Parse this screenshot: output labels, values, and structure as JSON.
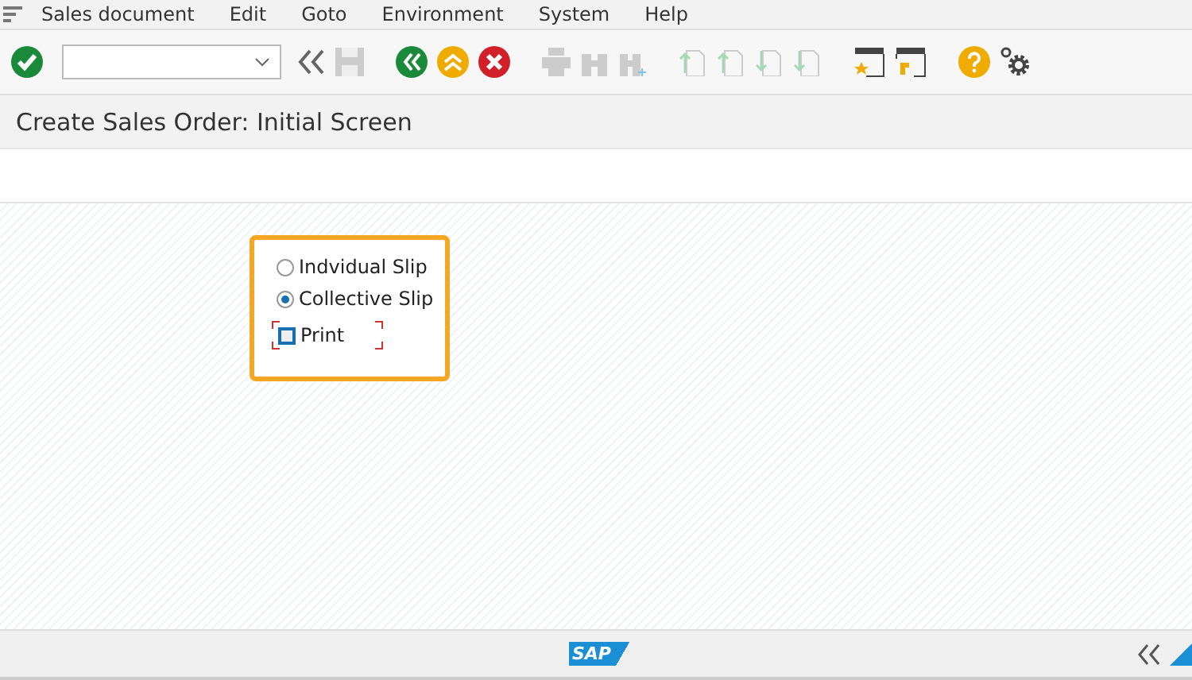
{
  "menu": [
    "Sales document",
    "Edit",
    "Goto",
    "Environment",
    "System",
    "Help"
  ],
  "title": "Create Sales Order: Initial Screen",
  "options": [
    {
      "kind": "radio",
      "label": "Indvidual Slip",
      "selected": false
    },
    {
      "kind": "radio",
      "label": "Collective Slip",
      "selected": true
    },
    {
      "kind": "checkbox",
      "label": "Print",
      "checked": false,
      "focused": true
    }
  ],
  "footer": {
    "logo": "SAP"
  }
}
